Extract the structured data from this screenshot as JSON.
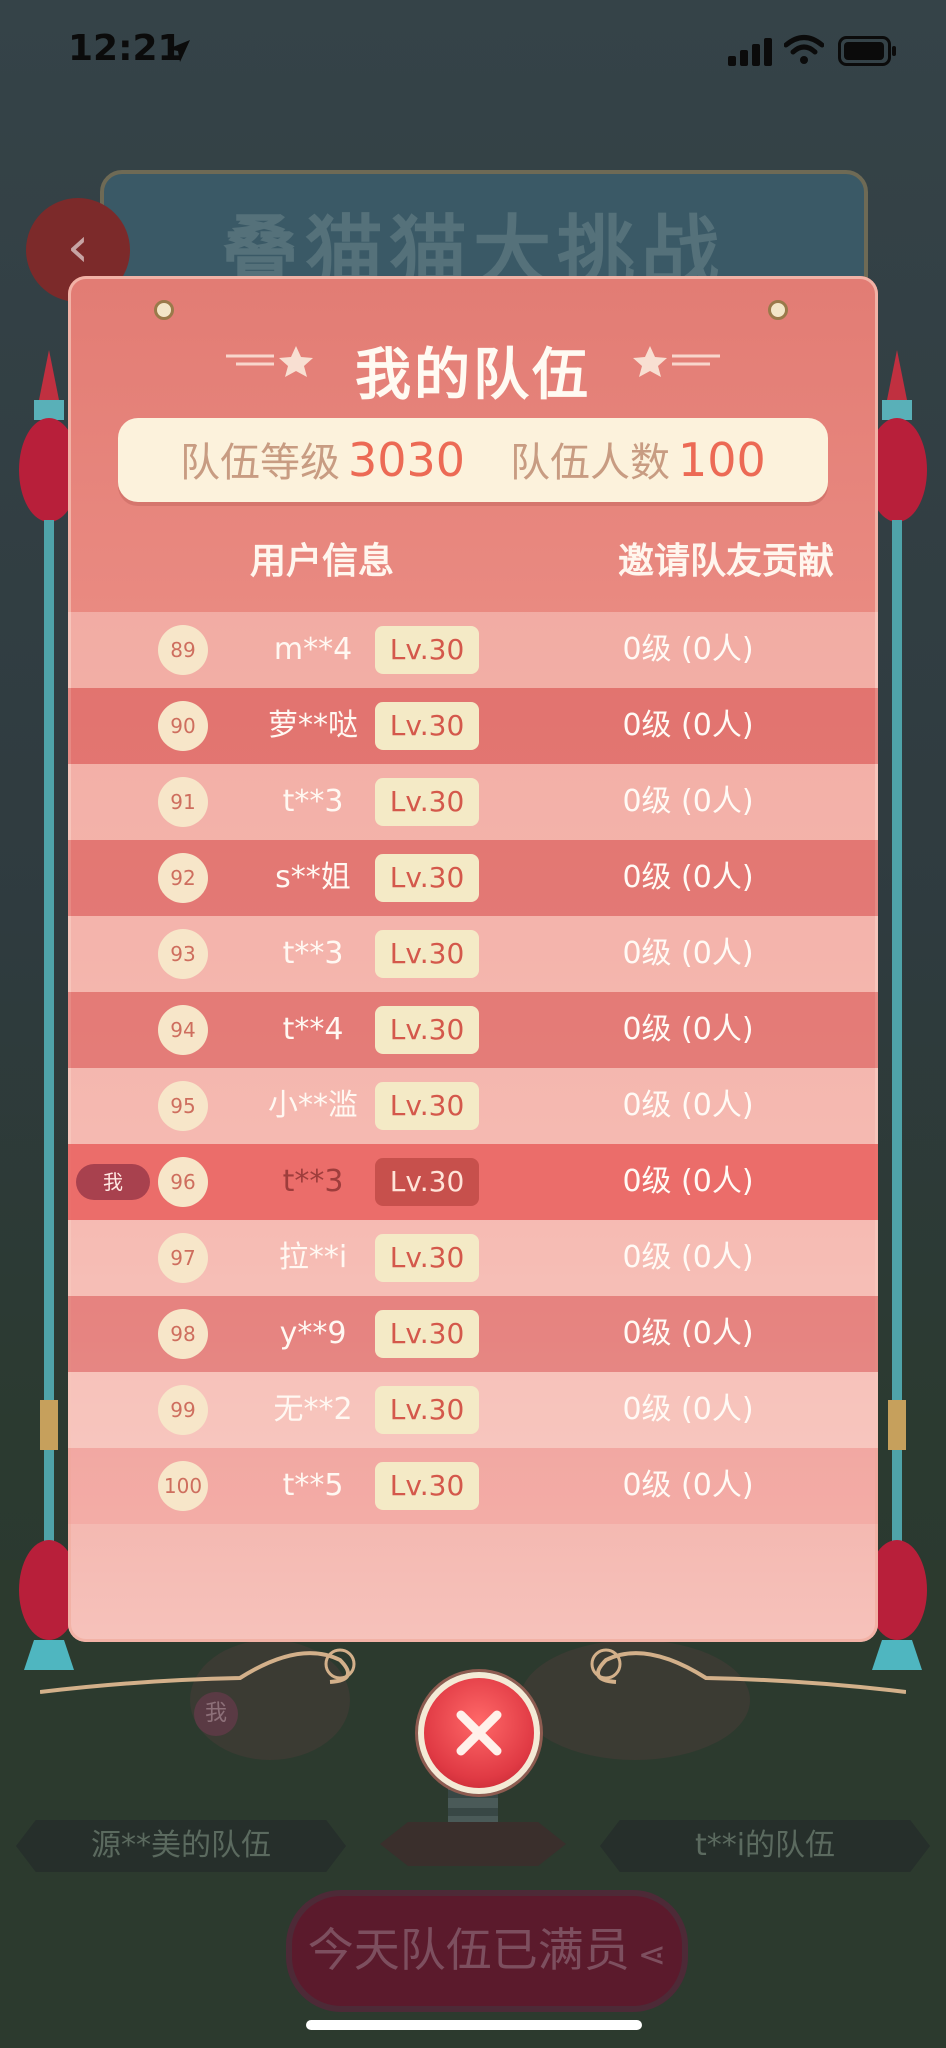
{
  "status_bar": {
    "time": "12:21"
  },
  "background": {
    "game_title": "叠猫猫大挑战",
    "left_team": "源**美的队伍",
    "right_team": "t**i的队伍",
    "full_button": "今天队伍已满员",
    "me_tag": "我"
  },
  "modal": {
    "title": "我的队伍",
    "team_level_label": "队伍等级",
    "team_level_value": "3030",
    "team_size_label": "队伍人数",
    "team_size_value": "100",
    "col_user": "用户信息",
    "col_contribution": "邀请队友贡献",
    "me_badge": "我",
    "rows": [
      {
        "rank": "89",
        "name": "m**4",
        "level": "Lv.30",
        "contribution": "0级 (0人)"
      },
      {
        "rank": "90",
        "name": "萝**哒",
        "level": "Lv.30",
        "contribution": "0级 (0人)"
      },
      {
        "rank": "91",
        "name": "t**3",
        "level": "Lv.30",
        "contribution": "0级 (0人)"
      },
      {
        "rank": "92",
        "name": "s**姐",
        "level": "Lv.30",
        "contribution": "0级 (0人)"
      },
      {
        "rank": "93",
        "name": "t**3",
        "level": "Lv.30",
        "contribution": "0级 (0人)"
      },
      {
        "rank": "94",
        "name": "t**4",
        "level": "Lv.30",
        "contribution": "0级 (0人)"
      },
      {
        "rank": "95",
        "name": "小**滥",
        "level": "Lv.30",
        "contribution": "0级 (0人)"
      },
      {
        "rank": "96",
        "name": "t**3",
        "level": "Lv.30",
        "contribution": "0级 (0人)"
      },
      {
        "rank": "97",
        "name": "拉**i",
        "level": "Lv.30",
        "contribution": "0级 (0人)"
      },
      {
        "rank": "98",
        "name": "y**9",
        "level": "Lv.30",
        "contribution": "0级 (0人)"
      },
      {
        "rank": "99",
        "name": "无**2",
        "level": "Lv.30",
        "contribution": "0级 (0人)"
      },
      {
        "rank": "100",
        "name": "t**5",
        "level": "Lv.30",
        "contribution": "0级 (0人)"
      }
    ]
  },
  "colors": {
    "accent": "#ec6a55",
    "modal_top": "#e27c74",
    "close_button": "#e03a44",
    "level_badge": "#f4eac6"
  }
}
